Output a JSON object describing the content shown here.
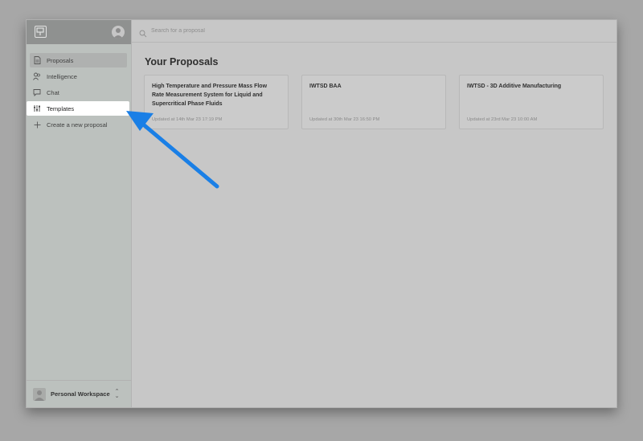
{
  "sidebar": {
    "items": [
      {
        "label": "Proposals",
        "icon": "document-icon"
      },
      {
        "label": "Intelligence",
        "icon": "users-icon"
      },
      {
        "label": "Chat",
        "icon": "chat-icon"
      },
      {
        "label": "Templates",
        "icon": "sliders-icon"
      },
      {
        "label": "Create a new proposal",
        "icon": "plus-icon"
      }
    ],
    "workspace": {
      "label": "Personal Workspace"
    }
  },
  "search": {
    "placeholder": "Search for a proposal"
  },
  "main": {
    "title": "Your Proposals",
    "cards": [
      {
        "title": "High Temperature and Pressure Mass Flow Rate Measurement System for Liquid and Supercritical Phase Fluids",
        "updated": "Updated at 14th Mar 23 17:19 PM"
      },
      {
        "title": "IWTSD BAA",
        "updated": "Updated at 30th Mar 23 16:50 PM"
      },
      {
        "title": "IWTSD - 3D Additive Manufacturing",
        "updated": "Updated at 23rd Mar 23 10:00 AM"
      }
    ]
  },
  "colors": {
    "arrow": "#1a7fe6",
    "highlight": "#ffffff"
  }
}
